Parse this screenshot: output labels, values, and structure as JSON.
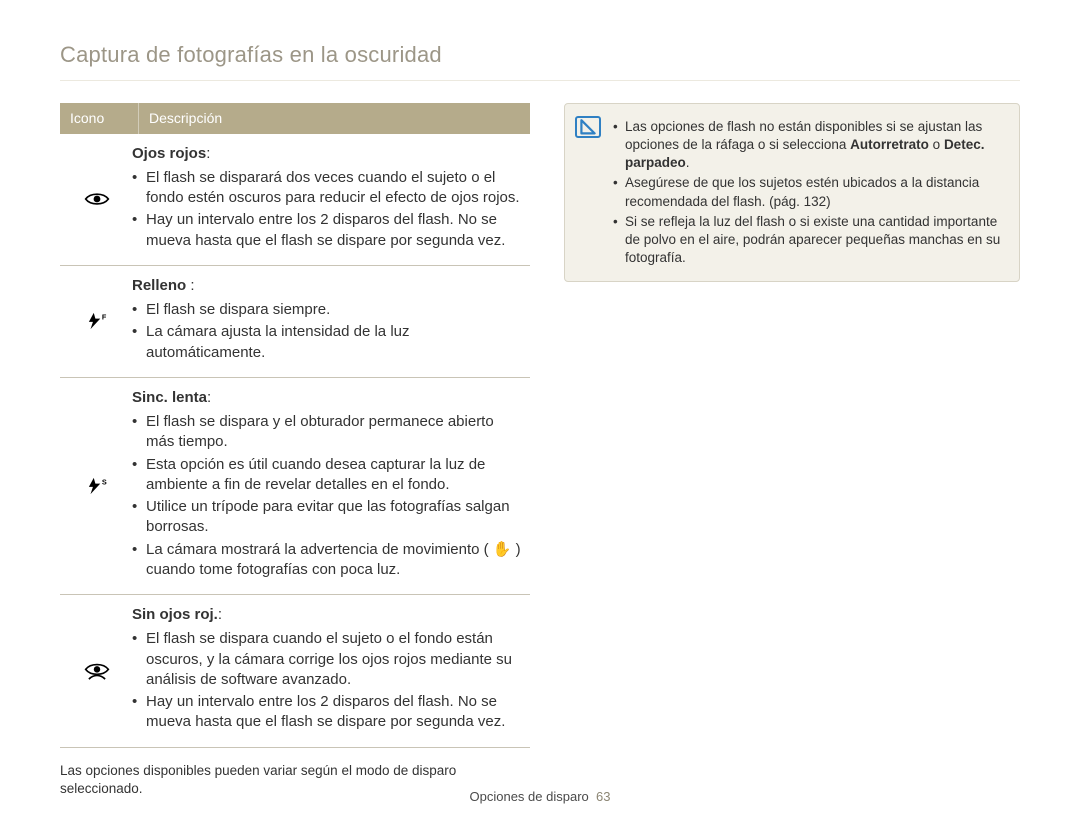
{
  "page": {
    "title": "Captura de fotografías en la oscuridad",
    "footer_label": "Opciones de disparo",
    "footer_page": "63"
  },
  "table": {
    "header_icon": "Icono",
    "header_desc": "Descripción",
    "footnote": "Las opciones disponibles pueden variar según el modo de disparo seleccionado.",
    "rows": [
      {
        "icon": "eye-icon",
        "title": "Ojos rojos",
        "title_suffix": ":",
        "bullets": [
          "El flash se disparará dos veces cuando el sujeto o el fondo estén oscuros para reducir el efecto de ojos rojos.",
          "Hay un intervalo entre los 2 disparos del flash. No se mueva hasta que el flash se dispare por segunda vez."
        ]
      },
      {
        "icon": "flash-f-icon",
        "title": "Relleno",
        "title_suffix": " :",
        "bullets": [
          "El flash se dispara siempre.",
          "La cámara ajusta la intensidad de la luz automáticamente."
        ]
      },
      {
        "icon": "flash-s-icon",
        "title": "Sinc. lenta",
        "title_suffix": ":",
        "bullets": [
          "El flash se dispara y el obturador permanece abierto más tiempo.",
          "Esta opción es útil cuando desea capturar la luz de ambiente a fin de revelar detalles en el fondo.",
          "Utilice un trípode para evitar que las fotografías salgan borrosas.",
          "La cámara mostrará la advertencia de movimiento ( ✋ ) cuando tome fotografías con poca luz."
        ]
      },
      {
        "icon": "eye-fix-icon",
        "title": "Sin ojos roj.",
        "title_suffix": ":",
        "bullets": [
          "El flash se dispara cuando el sujeto o el fondo están oscuros, y la cámara corrige los ojos rojos mediante su análisis de software avanzado.",
          "Hay un intervalo entre los 2 disparos del flash. No se mueva hasta que el flash se dispare por segunda vez."
        ]
      }
    ]
  },
  "note": {
    "items": [
      {
        "pre": "Las opciones de flash no están disponibles si se ajustan las opciones de la ráfaga o si selecciona ",
        "bold1": "Autorretrato",
        "mid": " o ",
        "bold2": "Detec. parpadeo",
        "post": "."
      },
      {
        "text": "Asegúrese de que los sujetos estén ubicados a la distancia recomendada del flash. (pág. 132)"
      },
      {
        "text": "Si se refleja la luz del flash o si existe una cantidad importante de polvo en el aire, podrán aparecer pequeñas manchas en su fotografía."
      }
    ]
  }
}
